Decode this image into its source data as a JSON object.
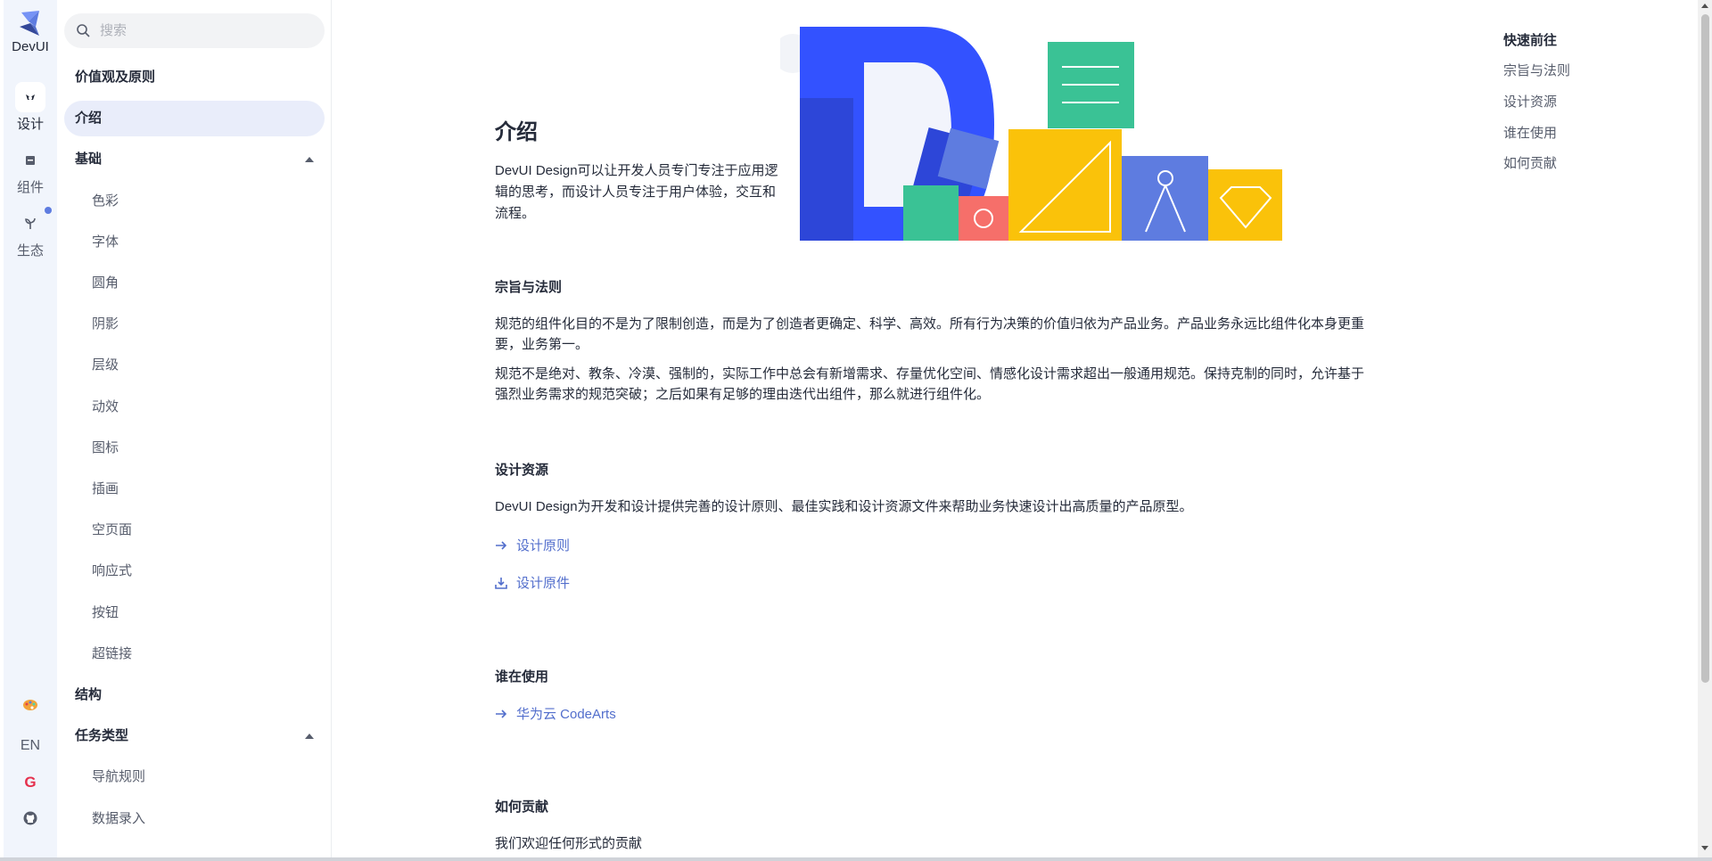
{
  "brand": {
    "name": "DevUI",
    "accent": "#5e7ce0"
  },
  "rail": {
    "items": [
      {
        "label": "设计",
        "icon": "bird-icon"
      },
      {
        "label": "组件",
        "icon": "component-icon"
      },
      {
        "label": "生态",
        "icon": "sprout-icon"
      }
    ],
    "lang": "EN"
  },
  "search": {
    "placeholder": "搜索",
    "value": ""
  },
  "sidebar": {
    "items": [
      {
        "label": "价值观及原则",
        "kind": "group"
      },
      {
        "label": "介绍",
        "kind": "active"
      },
      {
        "label": "基础",
        "kind": "group",
        "expanded": true
      },
      {
        "label": "色彩",
        "kind": "child"
      },
      {
        "label": "字体",
        "kind": "child"
      },
      {
        "label": "圆角",
        "kind": "child"
      },
      {
        "label": "阴影",
        "kind": "child"
      },
      {
        "label": "层级",
        "kind": "child"
      },
      {
        "label": "动效",
        "kind": "child"
      },
      {
        "label": "图标",
        "kind": "child"
      },
      {
        "label": "插画",
        "kind": "child"
      },
      {
        "label": "空页面",
        "kind": "child"
      },
      {
        "label": "响应式",
        "kind": "child"
      },
      {
        "label": "按钮",
        "kind": "child"
      },
      {
        "label": "超链接",
        "kind": "child"
      },
      {
        "label": "结构",
        "kind": "group"
      },
      {
        "label": "任务类型",
        "kind": "group",
        "expanded": true
      },
      {
        "label": "导航规则",
        "kind": "child"
      },
      {
        "label": "数据录入",
        "kind": "child"
      }
    ]
  },
  "hero": {
    "title": "介绍",
    "desc": "DevUI Design可以让开发人员专门专注于应用逻辑的思考，而设计人员专注于用户体验，交互和流程。"
  },
  "sections": {
    "principles": {
      "title": "宗旨与法则",
      "p1": "规范的组件化目的不是为了限制创造，而是为了创造者更确定、科学、高效。所有行为决策的价值归依为产品业务。产品业务永远比组件化本身更重要，业务第一。",
      "p2": "规范不是绝对、教条、冷漠、强制的，实际工作中总会有新增需求、存量优化空间、情感化设计需求超出一般通用规范。保持克制的同时，允许基于强烈业务需求的规范突破；之后如果有足够的理由迭代出组件，那么就进行组件化。"
    },
    "resources": {
      "title": "设计资源",
      "p": "DevUI Design为开发和设计提供完善的设计原则、最佳实践和设计资源文件来帮助业务快速设计出高质量的产品原型。",
      "link1": "设计原则",
      "link2": "设计原件"
    },
    "users": {
      "title": "谁在使用",
      "link": "华为云 CodeArts"
    },
    "contribute": {
      "title": "如何贡献",
      "p": "我们欢迎任何形式的贡献"
    }
  },
  "quick": {
    "title": "快速前往",
    "items": [
      "宗旨与法则",
      "设计资源",
      "谁在使用",
      "如何贡献"
    ]
  },
  "colors": {
    "link": "#526ecc",
    "activeBg": "#e9edfa",
    "railBg": "#f1f5fc"
  }
}
